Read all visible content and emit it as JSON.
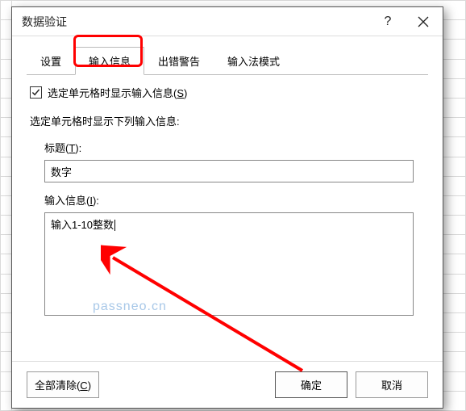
{
  "dialog": {
    "title": "数据验证",
    "help_tooltip": "帮助",
    "close_tooltip": "关闭"
  },
  "tabs": {
    "settings": "设置",
    "input_message": "输入信息",
    "error_alert": "出错警告",
    "ime_mode": "输入法模式",
    "active_index": 1
  },
  "checkbox": {
    "show_input_msg_label_pre": "选定单元格时显示输入信息(",
    "show_input_msg_key": "S",
    "show_input_msg_label_post": ")",
    "checked": true
  },
  "section_label": "选定单元格时显示下列输入信息:",
  "fields": {
    "title_label_pre": "标题(",
    "title_key": "T",
    "title_label_post": "):",
    "title_value": "数字",
    "msg_label_pre": "输入信息(",
    "msg_key": "I",
    "msg_label_post": "):",
    "msg_value": "输入1-10整数"
  },
  "buttons": {
    "clear_all_pre": "全部清除(",
    "clear_all_key": "C",
    "clear_all_post": ")",
    "ok": "确定",
    "cancel": "取消"
  },
  "watermark": "passneo.cn",
  "annotation": {
    "highlight_target": "tab-input-message",
    "arrow_target": "msg-textarea"
  }
}
